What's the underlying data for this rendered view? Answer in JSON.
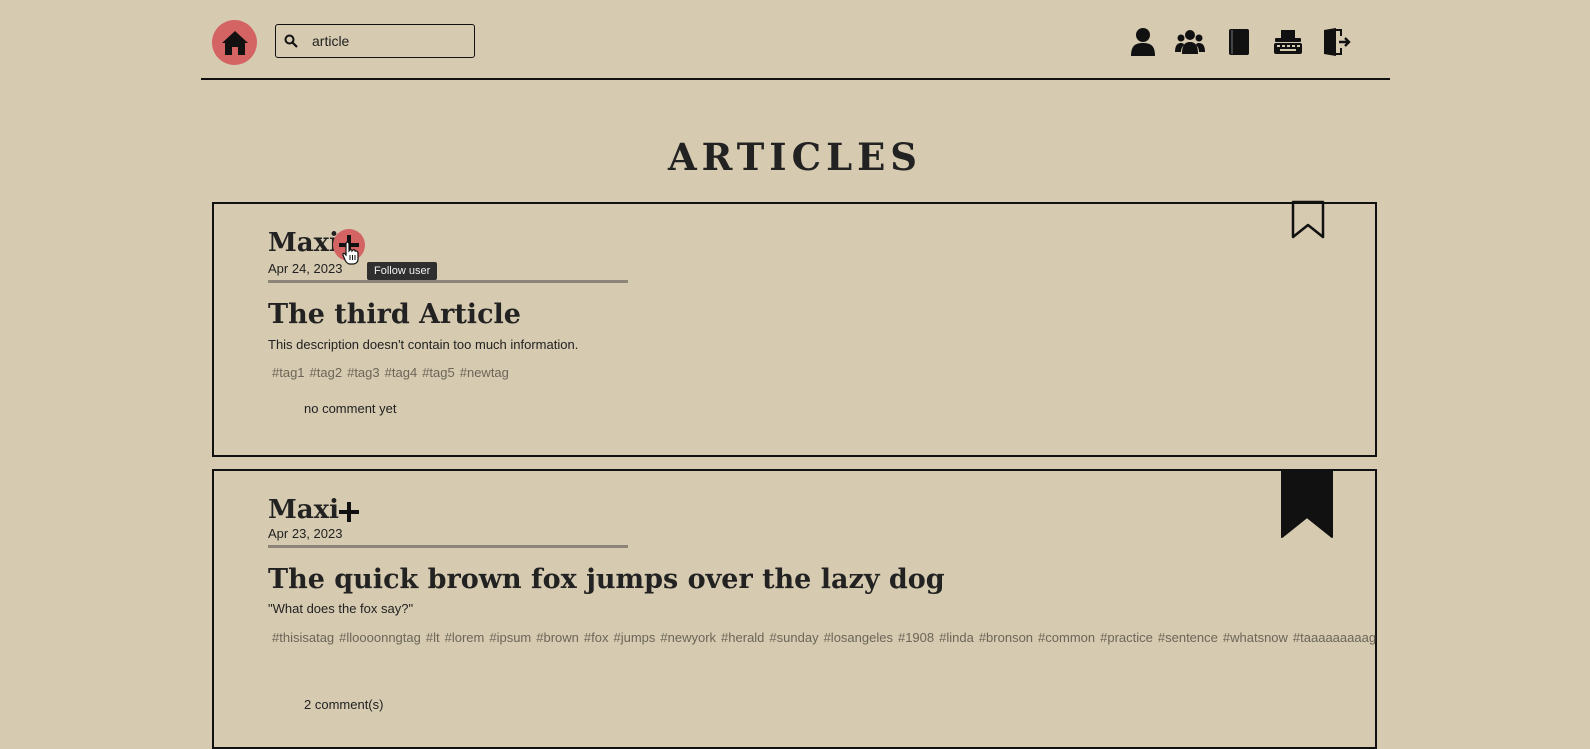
{
  "header": {
    "home_icon": "home-icon",
    "search": {
      "value": "article",
      "icon": "search-icon"
    },
    "nav_icons": [
      "user-icon",
      "users-icon",
      "book-icon",
      "typewriter-icon",
      "logout-icon"
    ]
  },
  "page": {
    "title": "ARTICLES"
  },
  "articles": [
    {
      "author": "Maxi",
      "date": "Apr 24, 2023",
      "title": "The third Article",
      "description": "This description doesn't contain too much information.",
      "tags": [
        "#tag1",
        "#tag2",
        "#tag3",
        "#tag4",
        "#tag5",
        "#newtag"
      ],
      "comments": "no comment yet",
      "bookmarked": false
    },
    {
      "author": "Maxi",
      "date": "Apr 23, 2023",
      "title": "The quick brown fox jumps over the lazy dog",
      "description": "\"What does the fox say?\"",
      "tags": [
        "#thisisatag",
        "#lloooonngtag",
        "#lt",
        "#lorem",
        "#ipsum",
        "#brown",
        "#fox",
        "#jumps",
        "#newyork",
        "#herald",
        "#sunday",
        "#losangeles",
        "#1908",
        "#linda",
        "#bronson",
        "#common",
        "#practice",
        "#sentence",
        "#whatsnow",
        "#taaaaaaaaag"
      ],
      "comments": "2 comment(s)",
      "bookmarked": true
    }
  ],
  "tooltip": {
    "text": "Follow user"
  },
  "colors": {
    "background": "#d6cab0",
    "accent": "#d46464",
    "text": "#222222",
    "divider": "#8d8577"
  }
}
